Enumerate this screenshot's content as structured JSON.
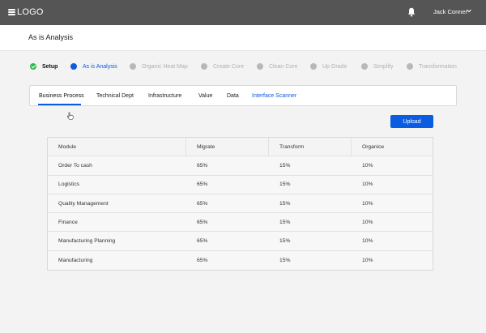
{
  "header": {
    "logo": "LOGO",
    "user_name": "Jack Conner"
  },
  "page": {
    "title": "As is Analysis"
  },
  "steps": [
    {
      "label": "Setup",
      "state": "done"
    },
    {
      "label": "As is Analysis",
      "state": "active"
    },
    {
      "label": "Organic Heat Map",
      "state": "pending"
    },
    {
      "label": "Create Core",
      "state": "pending"
    },
    {
      "label": "Clean Core",
      "state": "pending"
    },
    {
      "label": "Up Grade",
      "state": "pending"
    },
    {
      "label": "Simplify",
      "state": "pending"
    },
    {
      "label": "Transformation",
      "state": "pending"
    }
  ],
  "tabs": [
    {
      "label": "Business Process"
    },
    {
      "label": "Technical Dept"
    },
    {
      "label": "Infrastructure"
    },
    {
      "label": "Value"
    },
    {
      "label": "Data"
    },
    {
      "label": "Interface Scanner"
    }
  ],
  "upload_label": "Upload",
  "table": {
    "columns": [
      "Module",
      "Migrate",
      "Transform",
      "Organice"
    ],
    "rows": [
      [
        "Order To cash",
        "65%",
        "15%",
        "10%"
      ],
      [
        "Logistics",
        "65%",
        "15%",
        "10%"
      ],
      [
        "Quality Management",
        "65%",
        "15%",
        "10%"
      ],
      [
        "Finance",
        "65%",
        "15%",
        "10%"
      ],
      [
        "Manufacturing Planning",
        "65%",
        "15%",
        "10%"
      ],
      [
        "Manufacturing",
        "65%",
        "15%",
        "10%"
      ]
    ]
  },
  "colors": {
    "topbar": "#555555",
    "accent": "#0a5ce0",
    "done": "#2dbb4f",
    "pending": "#b8b8b8"
  }
}
